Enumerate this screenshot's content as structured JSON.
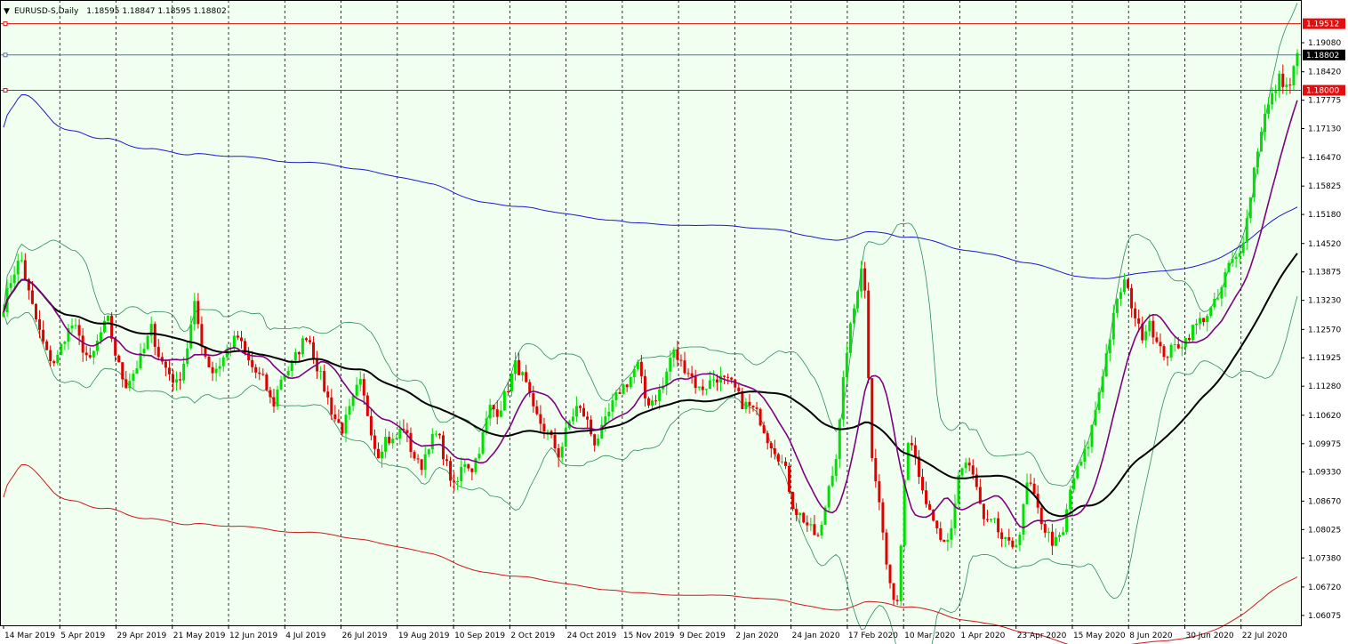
{
  "chart_data": {
    "type": "candlestick",
    "header": {
      "symbol_tf": "EURUSD-S,Daily",
      "ohlc": "1.18595 1.18847 1.18595 1.18802"
    },
    "ylim": [
      1.0585,
      1.2005
    ],
    "y_ticks": [
      "1.19080",
      "1.18420",
      "1.17775",
      "1.17130",
      "1.16470",
      "1.15825",
      "1.15180",
      "1.14520",
      "1.13875",
      "1.13230",
      "1.12570",
      "1.11925",
      "1.11280",
      "1.10620",
      "1.09975",
      "1.09330",
      "1.08670",
      "1.08025",
      "1.07380",
      "1.06720",
      "1.06075"
    ],
    "x_labels": [
      "14 Mar 2019",
      "5 Apr 2019",
      "29 Apr 2019",
      "21 May 2019",
      "12 Jun 2019",
      "4 Jul 2019",
      "26 Jul 2019",
      "19 Aug 2019",
      "10 Sep 2019",
      "2 Oct 2019",
      "24 Oct 2019",
      "15 Nov 2019",
      "9 Dec 2019",
      "2 Jan 2020",
      "24 Jan 2020",
      "17 Feb 2020",
      "10 Mar 2020",
      "1 Apr 2020",
      "23 Apr 2020",
      "15 May 2020",
      "8 Jun 2020",
      "30 Jun 2020",
      "22 Jul 2020"
    ],
    "horizontal_lines": [
      {
        "value": 1.19512,
        "label": "1.19512",
        "color": "#e01010"
      },
      {
        "value": 1.18802,
        "label": "1.18802",
        "color": "#5070b0"
      },
      {
        "value": 1.18,
        "label": "1.18000",
        "color": "#e01010"
      }
    ],
    "close_anchors": [
      1.131,
      1.138,
      1.142,
      1.133,
      1.126,
      1.12,
      1.118,
      1.124,
      1.127,
      1.122,
      1.118,
      1.124,
      1.128,
      1.119,
      1.113,
      1.116,
      1.12,
      1.126,
      1.119,
      1.116,
      1.113,
      1.12,
      1.131,
      1.121,
      1.116,
      1.118,
      1.122,
      1.124,
      1.119,
      1.116,
      1.114,
      1.108,
      1.115,
      1.117,
      1.121,
      1.125,
      1.118,
      1.112,
      1.106,
      1.103,
      1.108,
      1.114,
      1.106,
      1.097,
      1.101,
      1.1,
      1.104,
      1.098,
      1.094,
      1.1,
      1.102,
      1.095,
      1.089,
      1.096,
      1.094,
      1.1,
      1.108,
      1.107,
      1.112,
      1.118,
      1.114,
      1.107,
      1.104,
      1.101,
      1.097,
      1.104,
      1.108,
      1.106,
      1.1,
      1.103,
      1.108,
      1.112,
      1.114,
      1.118,
      1.109,
      1.11,
      1.113,
      1.121,
      1.118,
      1.116,
      1.112,
      1.113,
      1.115,
      1.114,
      1.113,
      1.109,
      1.108,
      1.106,
      1.101,
      1.098,
      1.094,
      1.085,
      1.083,
      1.08,
      1.078,
      1.09,
      1.098,
      1.12,
      1.131,
      1.143,
      1.098,
      1.084,
      1.067,
      1.064,
      1.102,
      1.098,
      1.086,
      1.083,
      1.076,
      1.078,
      1.093,
      1.096,
      1.09,
      1.081,
      1.082,
      1.078,
      1.076,
      1.079,
      1.092,
      1.085,
      1.08,
      1.077,
      1.079,
      1.091,
      1.095,
      1.1,
      1.11,
      1.12,
      1.13,
      1.137,
      1.131,
      1.124,
      1.128,
      1.121,
      1.12,
      1.122,
      1.123,
      1.126,
      1.128,
      1.13,
      1.133,
      1.14,
      1.142,
      1.148,
      1.162,
      1.173,
      1.178,
      1.183,
      1.18,
      1.188
    ],
    "indicators": [
      {
        "kind": "close",
        "name": "",
        "color": "#000000"
      },
      {
        "kind": "sma",
        "period": 50,
        "color": "#000000"
      },
      {
        "kind": "sma",
        "period": 13,
        "color": "#800080"
      },
      {
        "kind": "bands",
        "period": 20,
        "width": 2.0,
        "color": "#2e8b57"
      },
      {
        "kind": "envelope",
        "period": 120,
        "offset": 0.042,
        "upper_color": "#1a1acc",
        "lower_color": "#cc1a1a"
      }
    ],
    "candle_colors": {
      "up": "#00e000",
      "down": "#e00000"
    },
    "bar_count": 360
  }
}
